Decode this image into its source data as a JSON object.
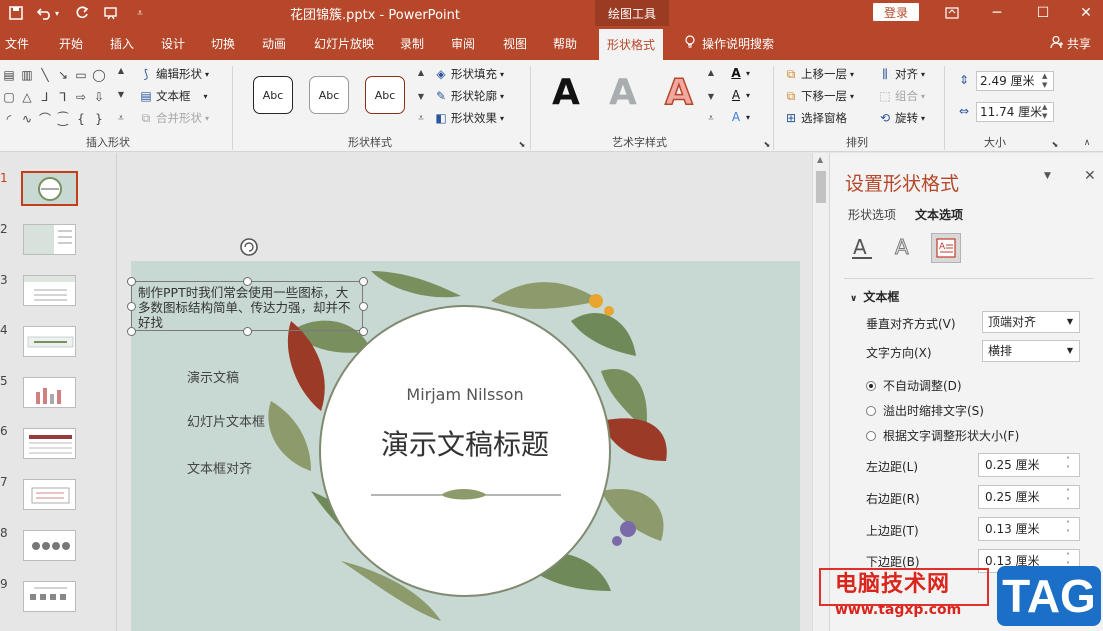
{
  "titlebar": {
    "title": "花团锦簇.pptx  -  PowerPoint",
    "context_tab_group": "绘图工具",
    "login": "登录",
    "undo_icon": "undo-icon",
    "redo_icon": "redo-icon"
  },
  "tabs": [
    {
      "label": "文件"
    },
    {
      "label": "开始"
    },
    {
      "label": "插入"
    },
    {
      "label": "设计"
    },
    {
      "label": "切换"
    },
    {
      "label": "动画"
    },
    {
      "label": "幻灯片放映"
    },
    {
      "label": "录制"
    },
    {
      "label": "审阅"
    },
    {
      "label": "视图"
    },
    {
      "label": "帮助"
    },
    {
      "label": "形状格式"
    },
    {
      "label": "操作说明搜索"
    }
  ],
  "share": "共享",
  "ribbon": {
    "insert_shapes": {
      "label": "插入形状",
      "edit_shape": "编辑形状",
      "text_box": "文本框",
      "merge_shapes": "合并形状"
    },
    "shape_styles": {
      "label": "形状样式",
      "sample": "Abc",
      "fill": "形状填充",
      "outline": "形状轮廓",
      "effects": "形状效果"
    },
    "wordart": {
      "label": "艺术字样式",
      "sample": "A"
    },
    "arrange": {
      "label": "排列",
      "bring_forward": "上移一层",
      "send_backward": "下移一层",
      "selection_pane": "选择窗格",
      "align": "对齐",
      "group": "组合",
      "rotate": "旋转"
    },
    "size": {
      "label": "大小",
      "height": "2.49 厘米",
      "width": "11.74 厘米"
    }
  },
  "slides": [
    {
      "num": "1"
    },
    {
      "num": "2"
    },
    {
      "num": "3"
    },
    {
      "num": "4"
    },
    {
      "num": "5"
    },
    {
      "num": "6"
    },
    {
      "num": "7"
    },
    {
      "num": "8"
    },
    {
      "num": "9"
    }
  ],
  "slide": {
    "textbox": "制作PPT时我们常会使用一些图标，大多数图标结构简单、传达力强，却并不好找",
    "items": [
      "演示文稿",
      "幻灯片文本框",
      "文本框对齐"
    ],
    "author": "Mirjam Nilsson",
    "title": "演示文稿标题"
  },
  "pane": {
    "title": "设置形状格式",
    "tab_shape": "形状选项",
    "tab_text": "文本选项",
    "section": "文本框",
    "valign_label": "垂直对齐方式(V)",
    "valign_value": "顶端对齐",
    "direction_label": "文字方向(X)",
    "direction_value": "横排",
    "radio_no_autofit": "不自动调整(D)",
    "radio_shrink": "溢出时缩排文字(S)",
    "radio_resize": "根据文字调整形状大小(F)",
    "left_margin_label": "左边距(L)",
    "left_margin": "0.25 厘米",
    "right_margin_label": "右边距(R)",
    "right_margin": "0.25 厘米",
    "top_margin_label": "上边距(T)",
    "top_margin": "0.13 厘米",
    "bottom_margin_label": "下边距(B)",
    "bottom_margin": "0.13 厘米"
  },
  "watermark": {
    "text": "电脑技术网",
    "url": "www.tagxp.com",
    "tag": "TAG"
  }
}
